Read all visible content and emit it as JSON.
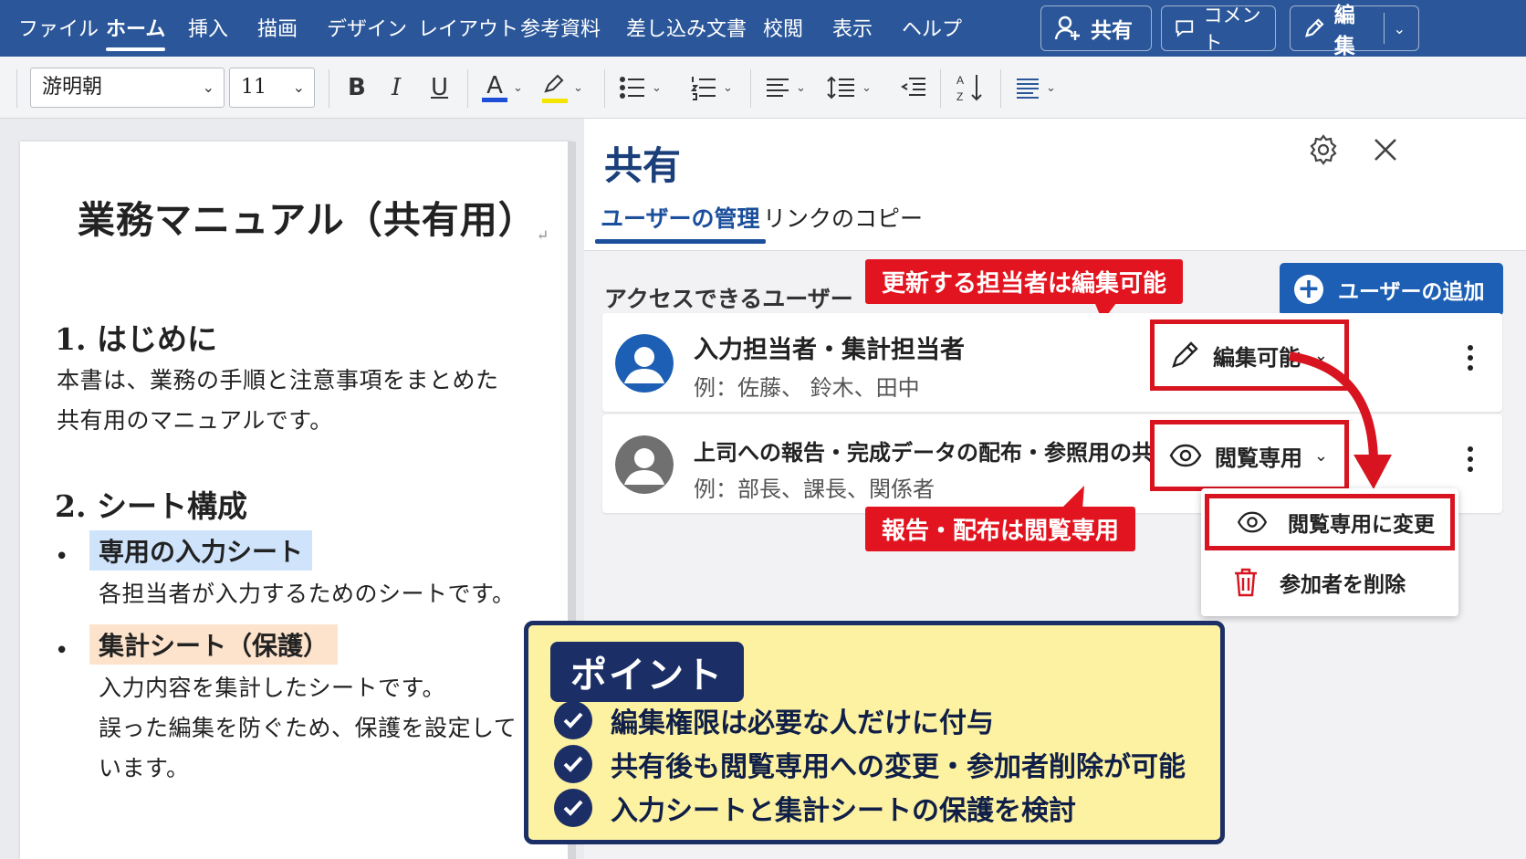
{
  "ribbon": {
    "tabs": [
      "ファイル",
      "ホーム",
      "挿入",
      "描画",
      "デザイン",
      "レイアウト",
      "参考資料",
      "差し込み文書",
      "校閲",
      "表示",
      "ヘルプ"
    ],
    "active_tab": "ホーム",
    "share_label": "共有",
    "comment_label": "コメント",
    "edit_label": "編集",
    "color": "#2b579a"
  },
  "toolbar": {
    "font_name": "游明朝",
    "font_size": "11",
    "bold": "B",
    "italic": "I",
    "underline": "U",
    "font_color_letter": "A",
    "font_color": "#1d4ed8",
    "highlight_color": "#f5e400"
  },
  "document": {
    "title": "業務マニュアル（共有用）",
    "return_mark": "↵",
    "sections": [
      {
        "heading": "1.  はじめに",
        "lines": [
          "本書は、業務の手順と注意事項をまとめた",
          "共有用のマニュアルです。"
        ]
      },
      {
        "heading": "2.  シート構成"
      }
    ],
    "items": [
      {
        "label": "専用の入力シート",
        "highlight": "#cfe3fb",
        "lines": [
          "各担当者が入力するためのシートです。"
        ]
      },
      {
        "label": "集計シート（保護）",
        "highlight": "#fde3cc",
        "lines": [
          "入力内容を集計したシートです。",
          "誤った編集を防ぐため、保護を設定して",
          "います。"
        ]
      }
    ],
    "bullet": "•"
  },
  "share_panel": {
    "title": "共有",
    "tabs": [
      "ユーザーの管理",
      "リンクのコピー"
    ],
    "section_title": "アクセスできるユーザー",
    "add_button": "ユーザーの追加",
    "users": [
      {
        "name": "入力担当者・集計担当者",
        "example": "例：佐藤、 鈴木、田中",
        "permission": "編集可能",
        "avatar_color": "#1d5fb4",
        "icon": "pencil-icon"
      },
      {
        "name": "上司への報告・完成データの配布・参照用の共有",
        "example": "例：部長、課長、関係者",
        "permission": "閲覧専用",
        "avatar_color": "#707070",
        "icon": "eye-icon"
      }
    ],
    "menu": [
      {
        "label": "閲覧専用に変更",
        "icon": "eye-icon"
      },
      {
        "label": "参加者を削除",
        "icon": "trash-icon"
      }
    ],
    "callouts": {
      "edit": "更新する担当者は編集可能",
      "view": "報告・配布は閲覧専用"
    },
    "accent_red": "#d7141f"
  },
  "point_box": {
    "tag": "ポイント",
    "items": [
      "編集権限は必要な人だけに付与",
      "共有後も閲覧専用への変更・参加者削除が可能",
      "入力シートと集計シートの保護を検討"
    ]
  }
}
